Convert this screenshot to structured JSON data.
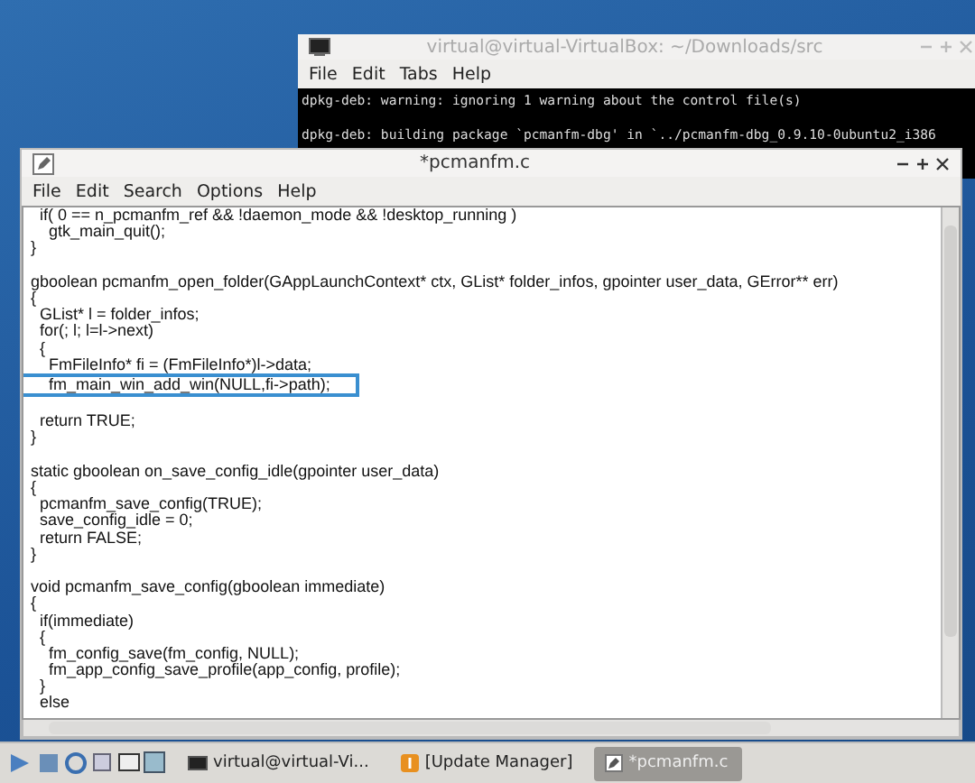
{
  "terminal": {
    "title": "virtual@virtual-VirtualBox: ~/Downloads/src",
    "menu": [
      "File",
      "Edit",
      "Tabs",
      "Help"
    ],
    "lines": [
      "dpkg-deb: warning: ignoring 1 warning about the control file(s)",
      "dpkg-deb: building package `pcmanfm-dbg' in `../pcmanfm-dbg_0.9.10-0ubuntu2_i386"
    ]
  },
  "editor": {
    "title": "*pcmanfm.c",
    "menu": [
      "File",
      "Edit",
      "Search",
      "Options",
      "Help"
    ],
    "lines": [
      {
        "kind": "code",
        "text": "  if( 0 == n_pcmanfm_ref && !daemon_mode && !desktop_running )",
        "highlighted": false
      },
      {
        "kind": "code",
        "text": "    gtk_main_quit();",
        "highlighted": false
      },
      {
        "kind": "code",
        "text": "}",
        "highlighted": false
      },
      {
        "kind": "blank",
        "highlighted": false
      },
      {
        "kind": "code",
        "text": "gboolean pcmanfm_open_folder(GAppLaunchContext* ctx, GList* folder_infos, gpointer user_data, GError** err)",
        "highlighted": false
      },
      {
        "kind": "code",
        "text": "{",
        "highlighted": false
      },
      {
        "kind": "code",
        "text": "  GList* l = folder_infos;",
        "highlighted": false
      },
      {
        "kind": "code",
        "text": "  for(; l; l=l->next)",
        "highlighted": false
      },
      {
        "kind": "code",
        "text": "  {",
        "highlighted": false
      },
      {
        "kind": "code",
        "text": "    FmFileInfo* fi = (FmFileInfo*)l->data;",
        "highlighted": false
      },
      {
        "kind": "code",
        "text": "    fm_main_win_add_win(NULL,fi->path);",
        "highlighted": true
      },
      {
        "kind": "blank",
        "highlighted": false
      },
      {
        "kind": "code",
        "text": "  return TRUE;",
        "highlighted": false
      },
      {
        "kind": "code",
        "text": "}",
        "highlighted": false
      },
      {
        "kind": "blank",
        "highlighted": false
      },
      {
        "kind": "code",
        "text": "static gboolean on_save_config_idle(gpointer user_data)",
        "highlighted": false
      },
      {
        "kind": "code",
        "text": "{",
        "highlighted": false
      },
      {
        "kind": "code",
        "text": "  pcmanfm_save_config(TRUE);",
        "highlighted": false
      },
      {
        "kind": "code",
        "text": "  save_config_idle = 0;",
        "highlighted": false
      },
      {
        "kind": "code",
        "text": "  return FALSE;",
        "highlighted": false
      },
      {
        "kind": "code",
        "text": "}",
        "highlighted": false
      },
      {
        "kind": "blank",
        "highlighted": false
      },
      {
        "kind": "code",
        "text": "void pcmanfm_save_config(gboolean immediate)",
        "highlighted": false
      },
      {
        "kind": "code",
        "text": "{",
        "highlighted": false
      },
      {
        "kind": "code",
        "text": "  if(immediate)",
        "highlighted": false
      },
      {
        "kind": "code",
        "text": "  {",
        "highlighted": false
      },
      {
        "kind": "code",
        "text": "    fm_config_save(fm_config, NULL);",
        "highlighted": false
      },
      {
        "kind": "code",
        "text": "    fm_app_config_save_profile(app_config, profile);",
        "highlighted": false
      },
      {
        "kind": "code",
        "text": "  }",
        "highlighted": false
      },
      {
        "kind": "code",
        "text": "  else",
        "highlighted": false
      }
    ]
  },
  "taskbar": {
    "tasks": [
      {
        "kind": "terminal",
        "label": "virtual@virtual-Vi...",
        "selected": false
      },
      {
        "kind": "update",
        "label": "[Update Manager]",
        "selected": false
      },
      {
        "kind": "editor",
        "label": "*pcmanfm.c",
        "selected": true
      }
    ]
  }
}
